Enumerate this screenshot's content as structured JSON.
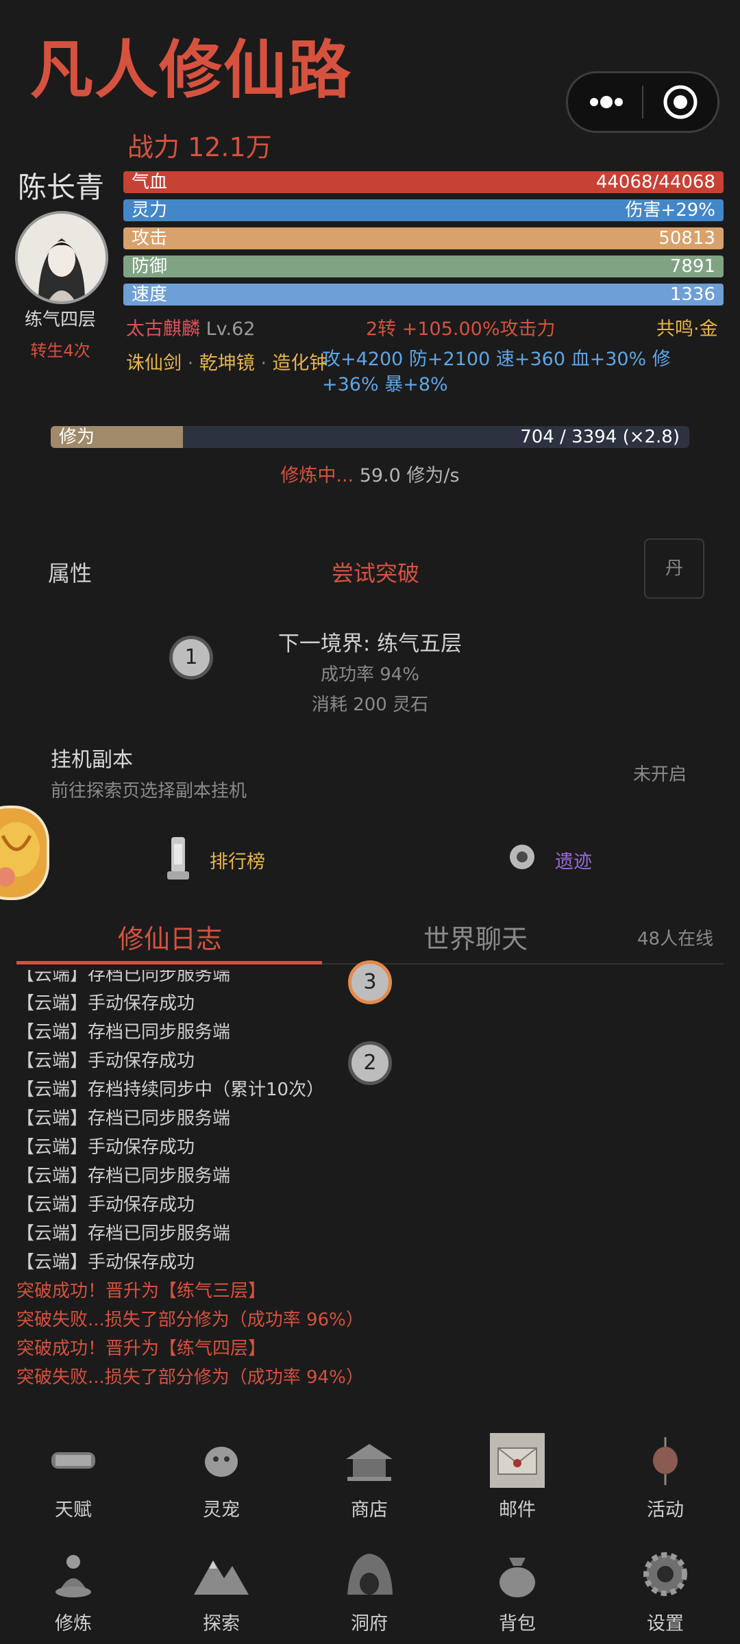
{
  "header": {
    "title": "凡人修仙路"
  },
  "player": {
    "power": "战力 12.1万",
    "name": "陈长青",
    "realm": "练气四层",
    "reborn": "转生4次"
  },
  "stats": [
    {
      "label": "气血",
      "value": "44068/44068",
      "color": "#c74135"
    },
    {
      "label": "灵力",
      "value": "伤害+29%",
      "color": "#4387c9"
    },
    {
      "label": "攻击",
      "value": "50813",
      "color": "#d9a16b"
    },
    {
      "label": "防御",
      "value": "7891",
      "color": "#80a384"
    },
    {
      "label": "速度",
      "value": "1336",
      "color": "#6e9fd6"
    }
  ],
  "pet": {
    "name": "太古麒麟",
    "level": "Lv.62",
    "rebirth": "2转 +105.00%攻击力",
    "resonance": "共鸣·金"
  },
  "equipment": {
    "items": [
      "诛仙剑",
      "乾坤镜",
      "造化钟"
    ],
    "bonus": "攻+4200 防+2100 速+360 血+30% 修+36% 暴+8%"
  },
  "cultivation": {
    "label": "修为",
    "value": "704 / 3394 (×2.8)",
    "fraction": 0.207,
    "status": "修炼中...",
    "rate": "59.0 修为/s"
  },
  "breakthrough": {
    "attr_label": "属性",
    "button": "尝试突破",
    "dan_button": "丹",
    "next_realm": "下一境界: 练气五层",
    "success_rate": "成功率 94%",
    "cost": "消耗 200 灵石"
  },
  "badges": [
    "1",
    "2",
    "3"
  ],
  "dungeon": {
    "title": "挂机副本",
    "subtitle": "前往探索页选择副本挂机",
    "status": "未开启"
  },
  "links": {
    "ranking": "排行榜",
    "ruins": "遗迹"
  },
  "tabs": {
    "log": "修仙日志",
    "chat": "世界聊天",
    "online": "48人在线"
  },
  "log": [
    {
      "text": "【云端】存档已同步服务端",
      "type": "normal"
    },
    {
      "text": "【云端】手动保存成功",
      "type": "normal"
    },
    {
      "text": "【云端】存档已同步服务端",
      "type": "normal"
    },
    {
      "text": "【云端】手动保存成功",
      "type": "normal"
    },
    {
      "text": "【云端】存档持续同步中（累计10次）",
      "type": "normal"
    },
    {
      "text": "【云端】存档已同步服务端",
      "type": "normal"
    },
    {
      "text": "【云端】手动保存成功",
      "type": "normal"
    },
    {
      "text": "【云端】存档已同步服务端",
      "type": "normal"
    },
    {
      "text": "【云端】手动保存成功",
      "type": "normal"
    },
    {
      "text": "【云端】存档已同步服务端",
      "type": "normal"
    },
    {
      "text": "【云端】手动保存成功",
      "type": "normal"
    },
    {
      "text": "突破成功！晋升为【练气三层】",
      "type": "event"
    },
    {
      "text": "突破失败...损失了部分修为（成功率 96%）",
      "type": "event"
    },
    {
      "text": "突破成功！晋升为【练气四层】",
      "type": "event"
    },
    {
      "text": "突破失败...损失了部分修为（成功率 94%）",
      "type": "event"
    }
  ],
  "nav_row1": [
    {
      "label": "天赋",
      "icon": "scroll-icon"
    },
    {
      "label": "灵宠",
      "icon": "pet-icon"
    },
    {
      "label": "商店",
      "icon": "pavilion-icon"
    },
    {
      "label": "邮件",
      "icon": "mail-icon"
    },
    {
      "label": "活动",
      "icon": "lantern-icon"
    }
  ],
  "nav_row2": [
    {
      "label": "修炼",
      "icon": "meditate-icon"
    },
    {
      "label": "探索",
      "icon": "mountain-icon"
    },
    {
      "label": "洞府",
      "icon": "cave-icon"
    },
    {
      "label": "背包",
      "icon": "bag-icon"
    },
    {
      "label": "设置",
      "icon": "gear-icon"
    }
  ]
}
